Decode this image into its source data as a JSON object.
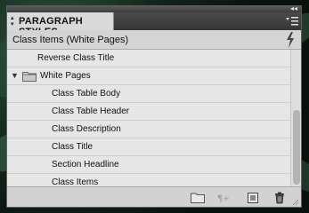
{
  "panel": {
    "tab_label": "PARAGRAPH STYLES",
    "current_style": "Class Items (White Pages)"
  },
  "styles": [
    {
      "label": "Reverse Class Title",
      "level": 1
    },
    {
      "label": "White Pages",
      "level": 0,
      "type": "group",
      "expanded": true
    },
    {
      "label": "Class Table Body",
      "level": 2
    },
    {
      "label": "Class Table Header",
      "level": 2
    },
    {
      "label": "Class Description",
      "level": 2
    },
    {
      "label": "Class Title",
      "level": 2
    },
    {
      "label": "Section Headline",
      "level": 2
    },
    {
      "label": "Class Items",
      "level": 2
    }
  ],
  "icons": {
    "collapse": "double-chevron-icon",
    "panel_menu": "panel-menu-icon",
    "quick_apply": "lightning-icon",
    "group": "folder-icon",
    "footer": [
      "new-group-icon",
      "clear-overrides-icon",
      "new-style-icon",
      "delete-icon"
    ]
  },
  "colors": {
    "panel_bg": "#d6d6d6",
    "list_bg": "#e6e6e6",
    "titlebar": "#3d3d3d"
  }
}
